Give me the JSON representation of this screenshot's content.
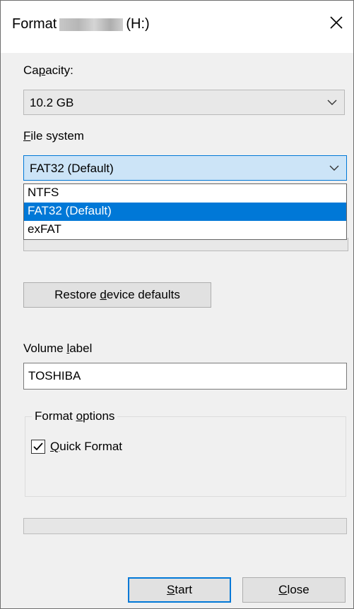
{
  "dialog": {
    "title_prefix": "Format",
    "title_suffix": "(H:)"
  },
  "capacity": {
    "label_pre": "Ca",
    "label_u": "p",
    "label_post": "acity:",
    "value": "10.2 GB"
  },
  "file_system": {
    "label_u": "F",
    "label_post": "ile system",
    "value": "FAT32 (Default)",
    "options": [
      "NTFS",
      "FAT32 (Default)",
      "exFAT"
    ],
    "selected_index": 1
  },
  "restore_button": {
    "pre": "Restore ",
    "u": "d",
    "post": "evice defaults"
  },
  "volume_label": {
    "label_pre": "Volume ",
    "label_u": "l",
    "label_post": "abel",
    "value": "TOSHIBA"
  },
  "format_options": {
    "title_pre": "Format ",
    "title_u": "o",
    "title_post": "ptions",
    "quick_format": {
      "label_u": "Q",
      "label_post": "uick Format",
      "checked": true
    }
  },
  "progress": {
    "fraction": 0
  },
  "buttons": {
    "start": {
      "u": "S",
      "post": "tart"
    },
    "close": {
      "u": "C",
      "post": "lose"
    }
  },
  "colors": {
    "accent": "#0078d7",
    "selected_combo_bg": "#cce4f7"
  }
}
